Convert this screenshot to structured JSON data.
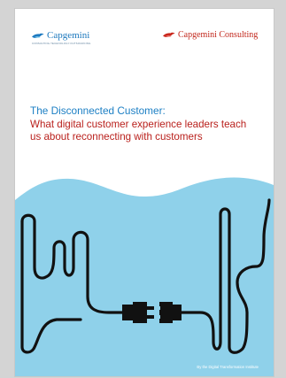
{
  "colors": {
    "page_background": "#d4d4d4",
    "cover_background": "#ffffff",
    "title_blue": "#1c7fc4",
    "subtitle_red": "#b9201c",
    "panel_blue": "#8fd1ea",
    "cable_black": "#111111"
  },
  "logos": {
    "left": {
      "text": "Capgemini",
      "subtext": "CONSULTING.TECHNOLOGY.OUTSOURCING"
    },
    "right": {
      "text": "Capgemini Consulting"
    }
  },
  "cover": {
    "title": "The Disconnected Customer:",
    "subtitle": "What digital customer experience leaders teach us about reconnecting with customers",
    "footer": "By the Digital Transformation Institute"
  },
  "icons": {
    "left_logo": "capgemini-spade-logo-icon",
    "right_logo": "capgemini-spade-logo-icon",
    "artwork": "disconnected-plug-cable-illustration"
  }
}
